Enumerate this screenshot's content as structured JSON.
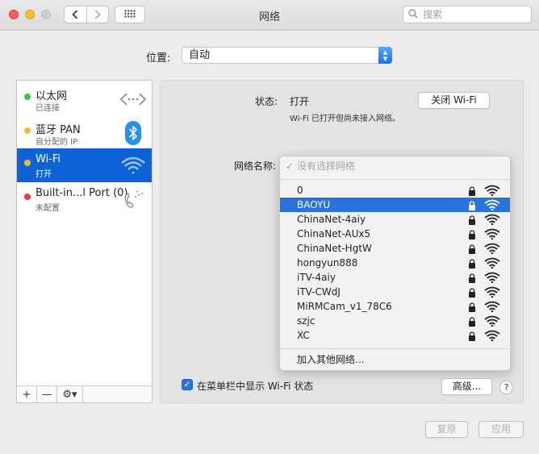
{
  "window": {
    "title": "网络"
  },
  "search": {
    "placeholder": "搜索"
  },
  "location": {
    "label": "位置:",
    "value": "自动"
  },
  "sidebar": {
    "services": [
      {
        "name": "以太网",
        "status": "已连接",
        "dot_color": "#34c84a",
        "icon": "ethernet-icon"
      },
      {
        "name": "蓝牙 PAN",
        "status": "自分配的 IP",
        "dot_color": "#f5b731",
        "icon": "bluetooth-icon"
      },
      {
        "name": "Wi-Fi",
        "status": "打开",
        "dot_color": "#f5b731",
        "icon": "wifi-icon"
      },
      {
        "name": "Built-in...l Port (0)",
        "status": "未配置",
        "dot_color": "#ee3b35",
        "icon": "modem-phone-icon"
      }
    ],
    "toolbar": {
      "add": "+",
      "remove": "—",
      "gear": "⚙▾"
    }
  },
  "detail": {
    "status_label": "状态:",
    "status_value": "打开",
    "turn_off_button": "关闭 Wi-Fi",
    "status_description": "Wi-Fi 已打开但尚未接入网络。",
    "network_name_label": "网络名称:",
    "show_in_menubar": "在菜单栏中显示 Wi-Fi 状态",
    "show_in_menubar_checked": true,
    "advanced_button": "高级...",
    "help": "?"
  },
  "network_menu": {
    "no_network": "没有选择网络",
    "networks": [
      "0",
      "BAOYU",
      "ChinaNet-4aiy",
      "ChinaNet-AUx5",
      "ChinaNet-HgtW",
      "hongyun888",
      "iTV-4aiy",
      "iTV-CWdJ",
      "MiRMCam_v1_78C6",
      "szjc",
      "XC"
    ],
    "selected": "BAOYU",
    "join_other": "加入其他网络..."
  },
  "footer": {
    "revert_button": "复原",
    "apply_button": "应用"
  },
  "colors": {
    "accent": "#2b72df",
    "sidebar_selected": "#0d63d6"
  }
}
